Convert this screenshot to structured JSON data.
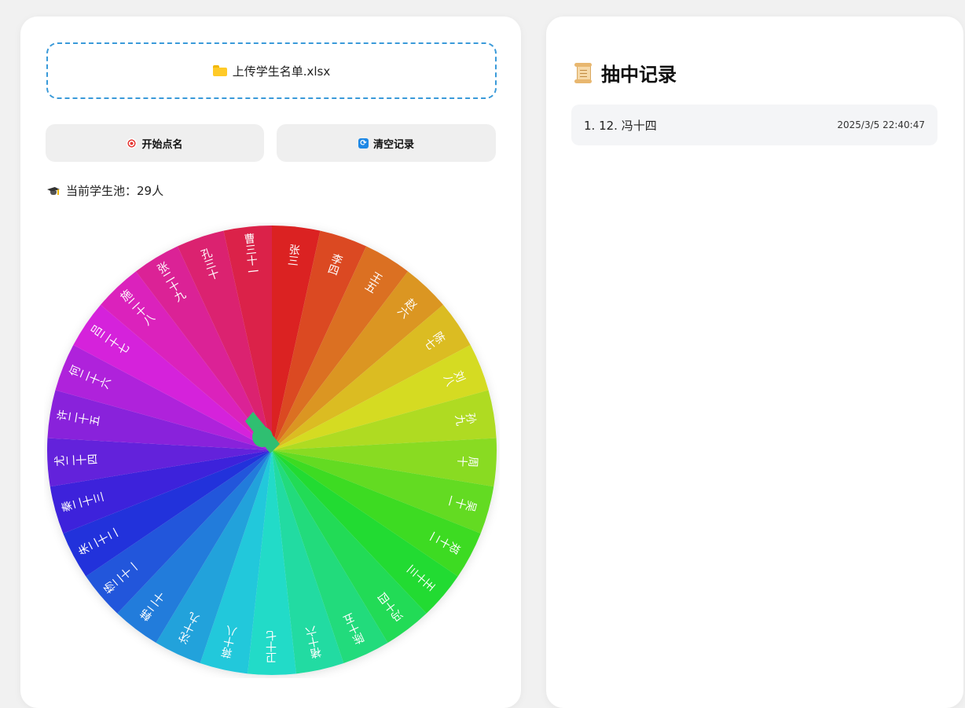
{
  "upload": {
    "label": "上传学生名单.xlsx",
    "icon": "folder-icon"
  },
  "buttons": {
    "start": {
      "label": "开始点名",
      "icon": "target-icon"
    },
    "clear": {
      "label": "清空记录",
      "icon": "refresh-icon"
    }
  },
  "pool": {
    "label": "当前学生池：29人",
    "icon": "graduation-cap-icon"
  },
  "wheel": {
    "names": [
      "张三",
      "李四",
      "王五",
      "赵六",
      "陈七",
      "刘八",
      "孙九",
      "周十",
      "吴十一",
      "郑十二",
      "王十三",
      "冯十四",
      "陈十五",
      "褚十六",
      "卫十七",
      "蒋十八",
      "沈十九",
      "韩二十",
      "杨二十一",
      "朱二十二",
      "秦二十三",
      "尤二十四",
      "许二十五",
      "何二十六",
      "吕二十七",
      "施二十八",
      "张二十九",
      "孔三十",
      "曹三十一"
    ],
    "pointer_color": "#2fbf71"
  },
  "records": {
    "title": "抽中记录",
    "icon": "scroll-icon",
    "items": [
      {
        "name": "1. 12. 冯十四",
        "time": "2025/3/5 22:40:47"
      }
    ]
  }
}
